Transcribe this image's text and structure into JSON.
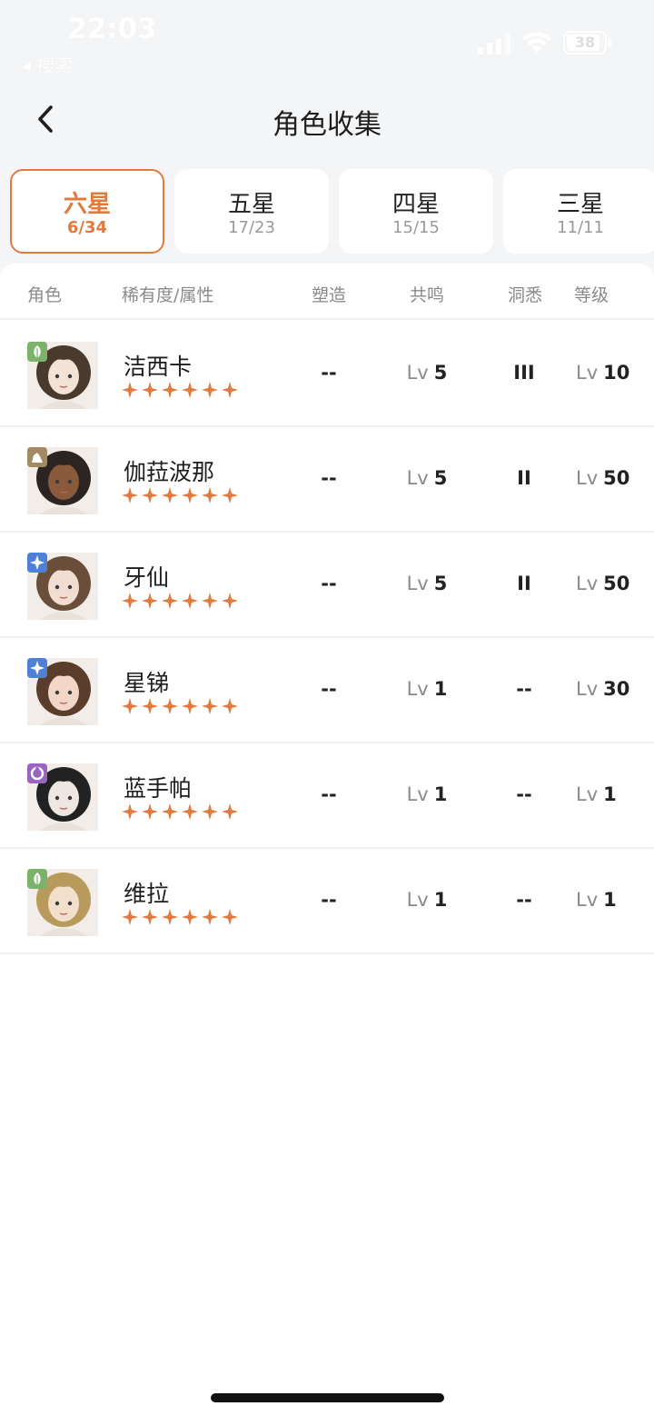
{
  "status_bar": {
    "time": "22:03",
    "back_app": "◂ 搜索",
    "battery": "38"
  },
  "header": {
    "title": "角色收集",
    "back_icon": "chevron-left-icon"
  },
  "tabs": [
    {
      "label": "六星",
      "count": "6/34",
      "active": true
    },
    {
      "label": "五星",
      "count": "17/23",
      "active": false
    },
    {
      "label": "四星",
      "count": "15/15",
      "active": false
    },
    {
      "label": "三星",
      "count": "11/11",
      "active": false
    }
  ],
  "columns": {
    "role": "角色",
    "rarity": "稀有度/属性",
    "shape": "塑造",
    "resonance": "共鸣",
    "insight": "洞悉",
    "level": "等级"
  },
  "level_prefix": "Lv",
  "accent_color": "#e07a3f",
  "rows": [
    {
      "name": "洁西卡",
      "stars": 6,
      "attribute": "plant-icon",
      "attr_color": "#7bb36a",
      "shape": "--",
      "resonance": "5",
      "insight": "III",
      "level": "10"
    },
    {
      "name": "伽菈波那",
      "stars": 6,
      "attribute": "beast-icon",
      "attr_color": "#a48a63",
      "shape": "--",
      "resonance": "5",
      "insight": "II",
      "level": "50"
    },
    {
      "name": "牙仙",
      "stars": 6,
      "attribute": "star-icon",
      "attr_color": "#4f7fd6",
      "shape": "--",
      "resonance": "5",
      "insight": "II",
      "level": "50"
    },
    {
      "name": "星锑",
      "stars": 6,
      "attribute": "star-icon",
      "attr_color": "#4f7fd6",
      "shape": "--",
      "resonance": "1",
      "insight": "--",
      "level": "30"
    },
    {
      "name": "蓝手帕",
      "stars": 6,
      "attribute": "spirit-icon",
      "attr_color": "#9a63c2",
      "shape": "--",
      "resonance": "1",
      "insight": "--",
      "level": "1"
    },
    {
      "name": "维拉",
      "stars": 6,
      "attribute": "plant-icon",
      "attr_color": "#7bb36a",
      "shape": "--",
      "resonance": "1",
      "insight": "--",
      "level": "1"
    }
  ]
}
